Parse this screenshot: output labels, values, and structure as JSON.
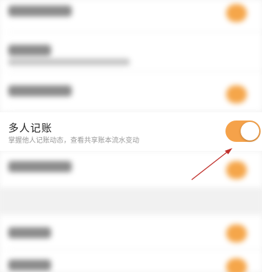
{
  "setting": {
    "title": "多人记账",
    "description": "掌握他人记账动态，查看共享账本流水变动",
    "toggle_state": "on"
  },
  "colors": {
    "accent": "#f5a24a",
    "annotation_arrow": "#c0302b"
  },
  "icons": {
    "annotation": "arrow-pointer"
  }
}
